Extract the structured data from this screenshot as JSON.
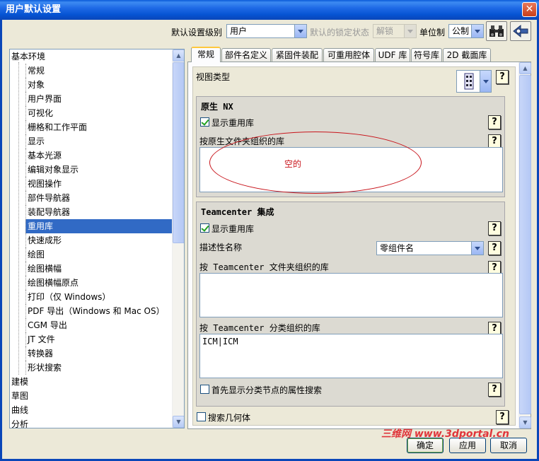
{
  "window": {
    "title": "用户默认设置",
    "close": "✕"
  },
  "toolbar": {
    "level_label": "默认设置级别",
    "level_value": "用户",
    "lock_label": "默认的锁定状态",
    "lock_value": "解锁",
    "unit_label": "单位制",
    "unit_value": "公制",
    "find_icon": "binoculars-icon",
    "manage_icon": "settings-manager-icon"
  },
  "tree": {
    "root": "基本环境",
    "children": [
      "常规",
      "对象",
      "用户界面",
      "可视化",
      "栅格和工作平面",
      "显示",
      "基本光源",
      "编辑对象显示",
      "视图操作",
      "部件导航器",
      "装配导航器",
      "重用库",
      "快速成形",
      "绘图",
      "绘图横幅",
      "绘图横幅原点",
      "打印（仅 Windows）",
      "PDF 导出（Windows 和 Mac OS）",
      "CGM 导出",
      "JT 文件",
      "转换器",
      "形状搜索"
    ],
    "selected_index": 11,
    "roots_after": [
      "建模",
      "草图",
      "曲线",
      "分析"
    ]
  },
  "tabs": [
    "常规",
    "部件名定义",
    "紧固件装配",
    "可重用腔体",
    "UDF 库",
    "符号库",
    "2D 截面库"
  ],
  "content": {
    "view_type_label": "视图类型",
    "native": {
      "title": "原生 NX",
      "show_lib_label": "显示重用库",
      "folder_lib_label": "按原生文件夹组织的库",
      "empty_note": "空的"
    },
    "teamcenter": {
      "title": "Teamcenter 集成",
      "show_lib_label": "显示重用库",
      "desc_name_label": "描述性名称",
      "desc_name_value": "零组件名",
      "folder_lib_label": "按 Teamcenter 文件夹组织的库",
      "class_lib_label": "按 Teamcenter 分类组织的库",
      "class_lib_value": "ICM|ICM",
      "attr_search_label": "首先显示分类节点的属性搜索"
    },
    "search_geometry_label": "搜索几何体",
    "help": "?"
  },
  "buttons": {
    "ok": "确定",
    "apply": "应用",
    "cancel": "取消"
  },
  "watermark": "三维网 www.3dportal.cn"
}
